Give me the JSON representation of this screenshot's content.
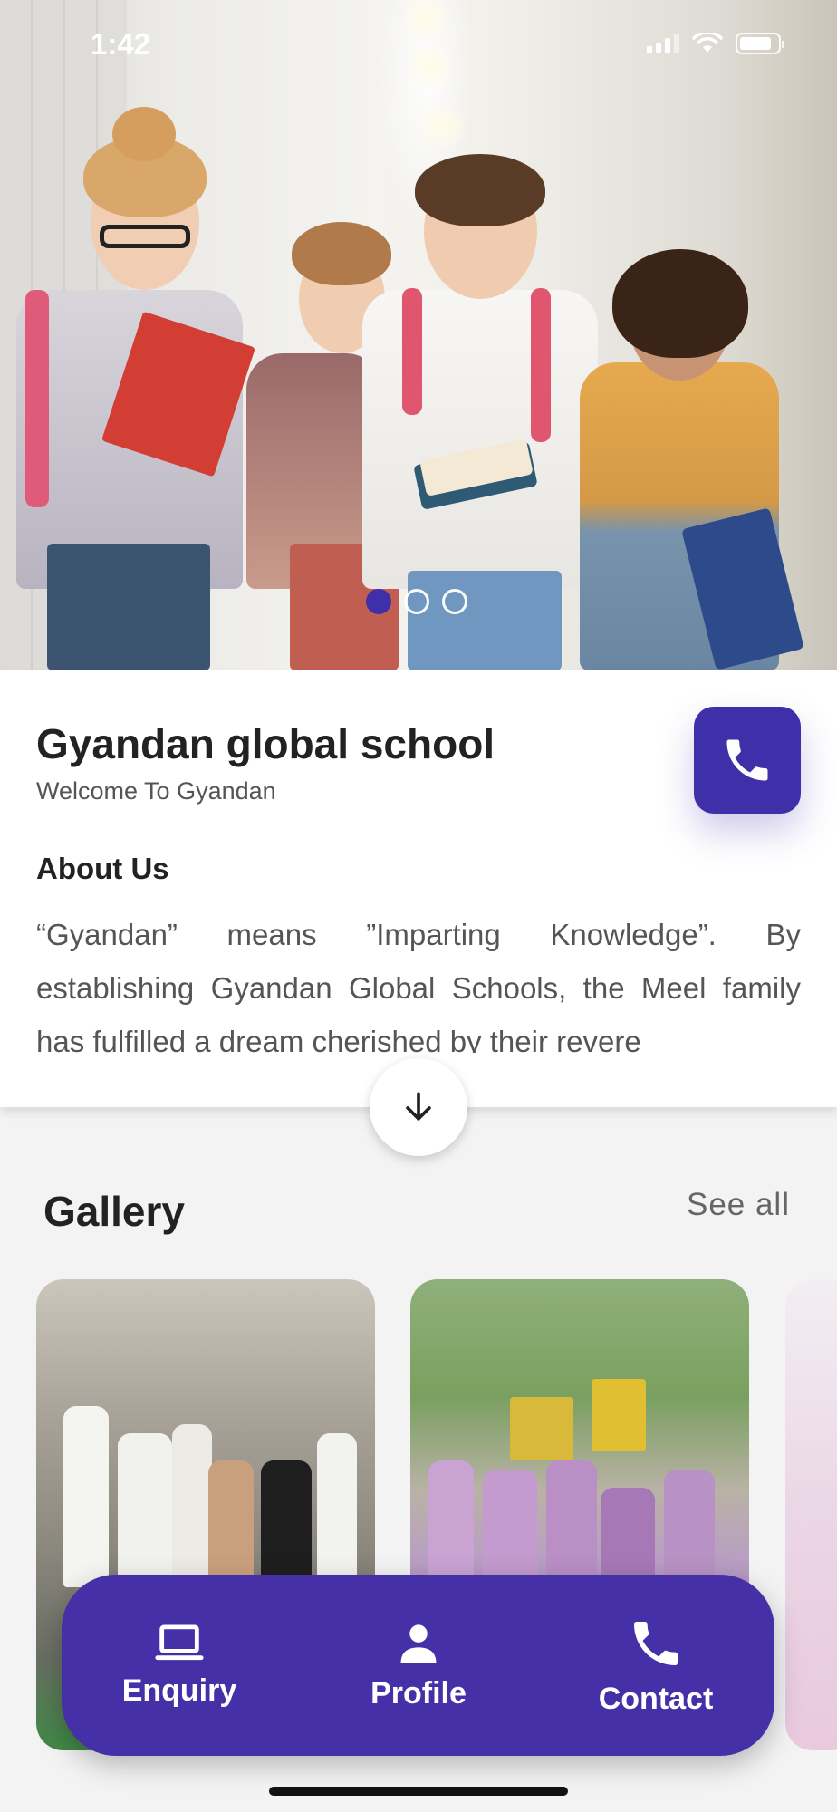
{
  "status_bar": {
    "time": "1:42"
  },
  "hero": {
    "slides": 3,
    "active_slide": 1
  },
  "school": {
    "name": "Gyandan global school",
    "tagline": "Welcome To Gyandan"
  },
  "about": {
    "title": "About Us",
    "text": "“Gyandan” means ”Imparting Knowledge”. By establishing Gyandan Global Schools, the Meel family has fulfilled a dream cherished by their revere"
  },
  "gallery": {
    "title": "Gallery",
    "see_all": "See all"
  },
  "bottom_nav": {
    "items": [
      {
        "label": "Enquiry",
        "icon": "laptop-icon"
      },
      {
        "label": "Profile",
        "icon": "person-icon"
      },
      {
        "label": "Contact",
        "icon": "phone-icon"
      }
    ]
  },
  "colors": {
    "accent": "#4530a8",
    "active_dot": "#3f2fa8"
  }
}
